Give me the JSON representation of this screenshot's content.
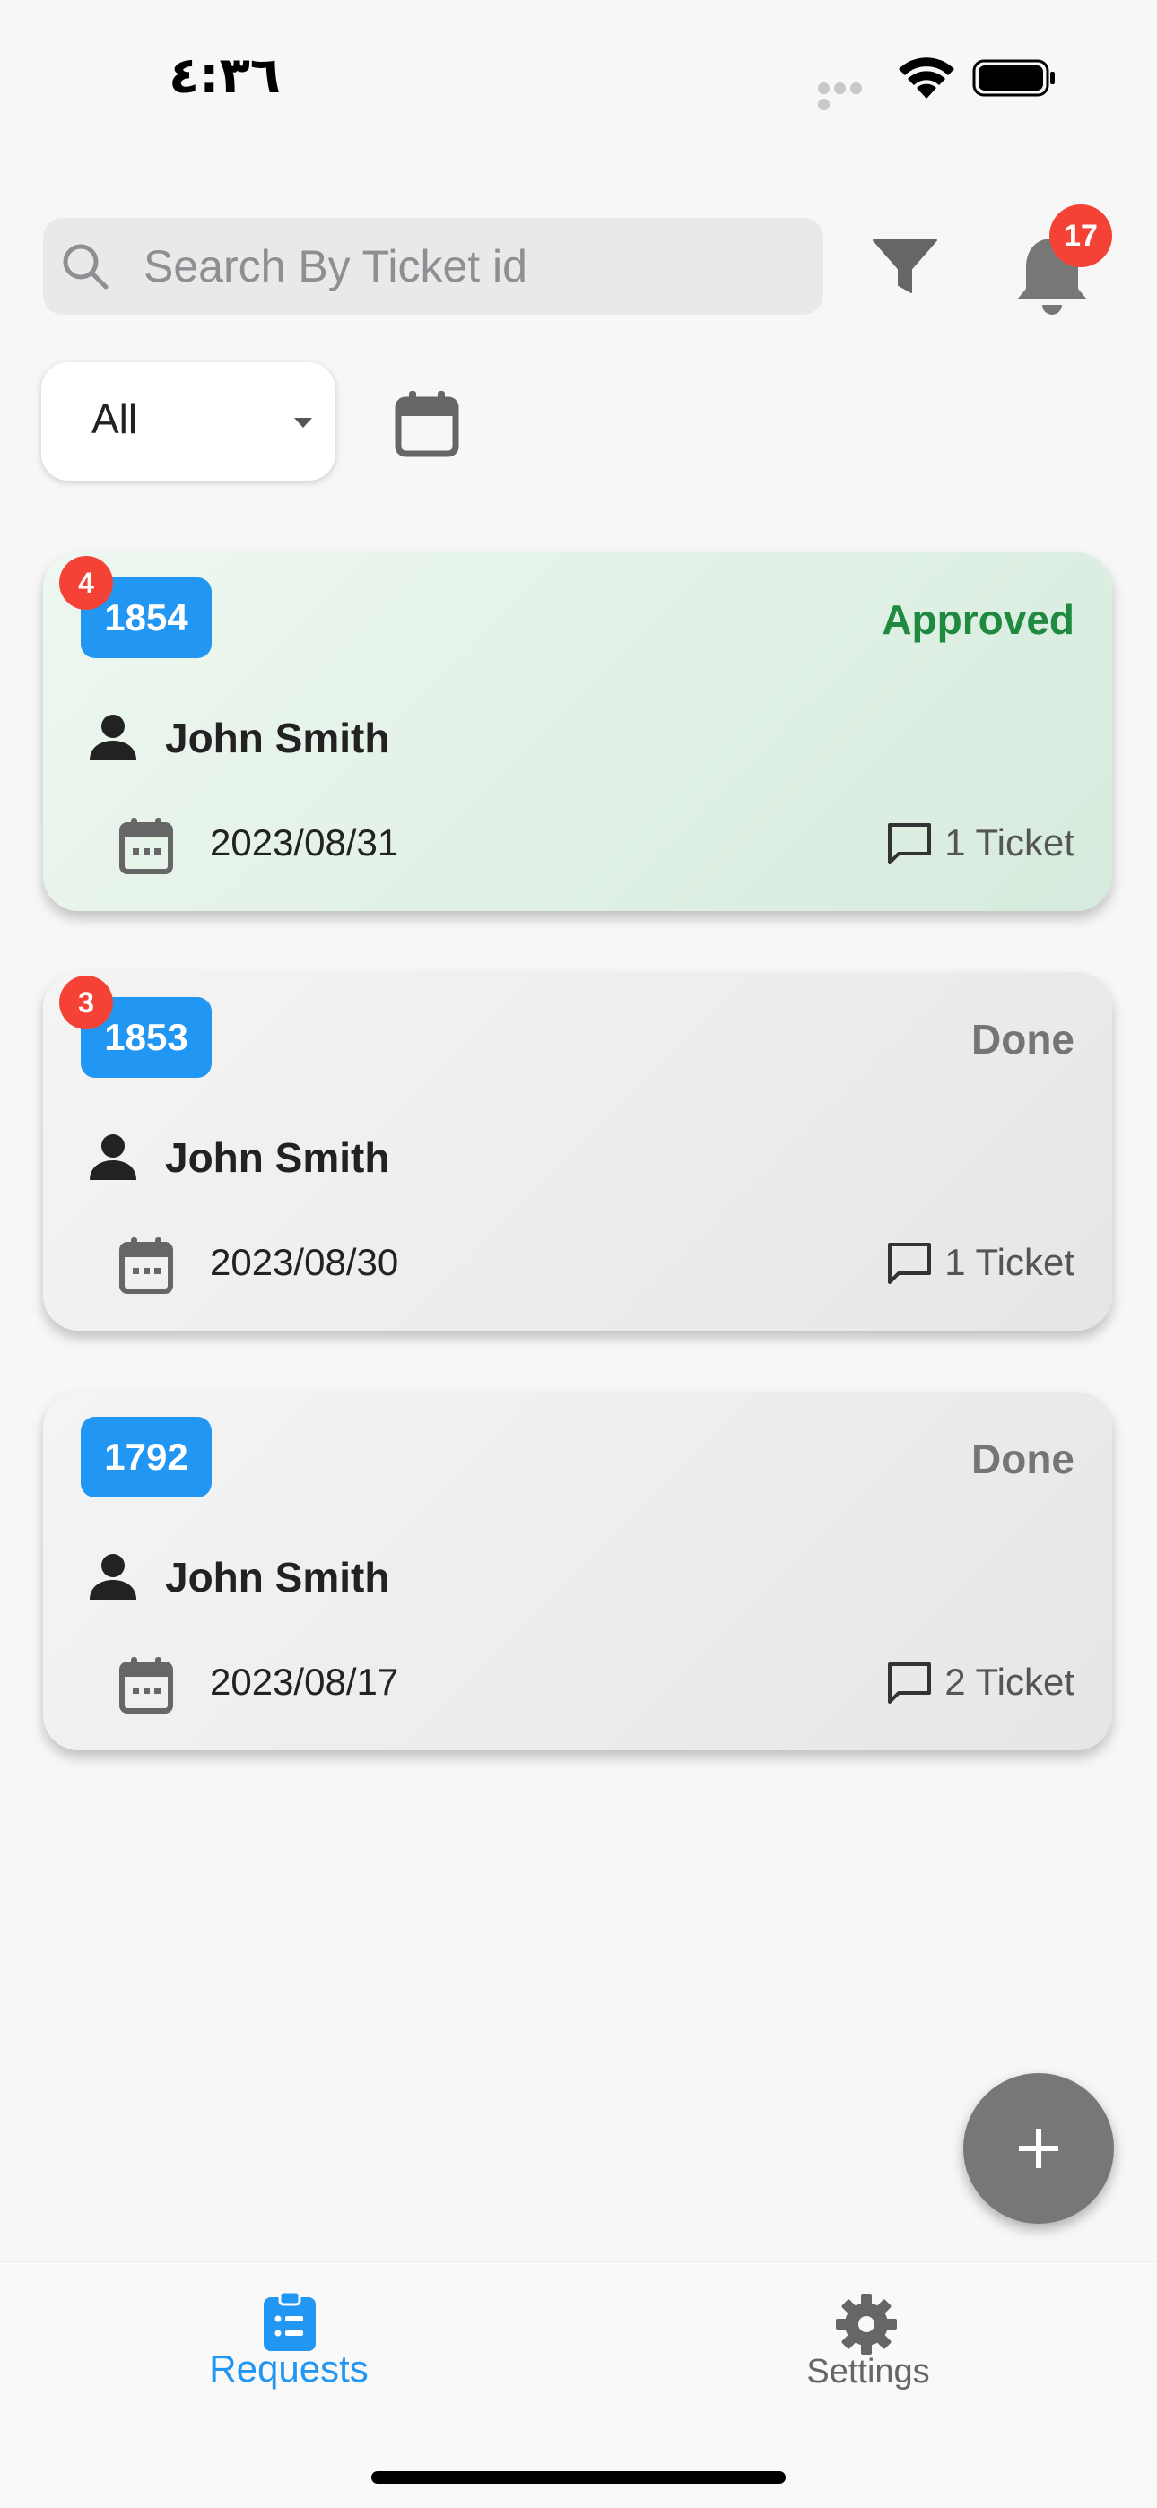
{
  "status_bar": {
    "time": "٤:٣٦"
  },
  "search": {
    "placeholder": "Search By Ticket id"
  },
  "notifications": {
    "count": "17"
  },
  "filter": {
    "selected": "All"
  },
  "requests": [
    {
      "id": "1854",
      "badge": "4",
      "status": "Approved",
      "name": "John Smith",
      "date": "2023/08/31",
      "tickets": "1 Ticket"
    },
    {
      "id": "1853",
      "badge": "3",
      "status": "Done",
      "name": "John Smith",
      "date": "2023/08/30",
      "tickets": "1 Ticket"
    },
    {
      "id": "1792",
      "badge": "",
      "status": "Done",
      "name": "John Smith",
      "date": "2023/08/17",
      "tickets": "2 Ticket"
    }
  ],
  "bottom_nav": {
    "requests_label": "Requests",
    "settings_label": "Settings"
  },
  "colors": {
    "accent": "#2196f3",
    "badge": "#f44336",
    "approved": "#1f8a3f",
    "done": "#757575"
  }
}
